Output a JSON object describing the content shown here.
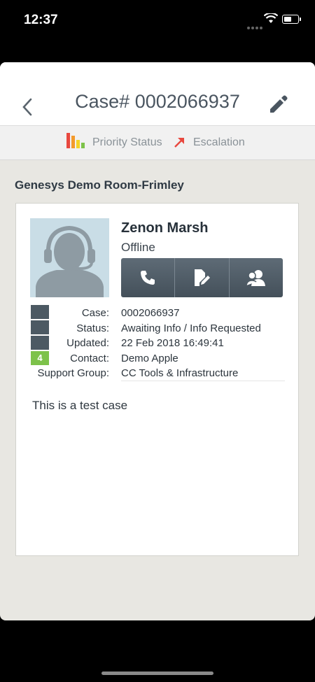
{
  "status_bar": {
    "time": "12:37"
  },
  "header": {
    "title": "Case# 0002066937"
  },
  "subbar": {
    "priority_label": "Priority Status",
    "escalation_label": "Escalation"
  },
  "room": "Genesys Demo Room-Frimley",
  "contact": {
    "name": "Zenon Marsh",
    "presence": "Offline"
  },
  "priority": {
    "level": "4",
    "level_fraction": 0.25
  },
  "details": [
    {
      "key": "Case:",
      "value": "0002066937"
    },
    {
      "key": "Status:",
      "value": "Awaiting Info / Info Requested"
    },
    {
      "key": "Updated:",
      "value": "22 Feb 2018 16:49:41"
    },
    {
      "key": "Contact:",
      "value": "Demo Apple"
    },
    {
      "key": "Support Group:",
      "value": "CC Tools & Infrastructure"
    }
  ],
  "description": "This is a test case",
  "colors": {
    "accent": "#4a5560",
    "priority_green": "#7dc24a",
    "escalation_red": "#e8483f"
  },
  "icons": [
    "back-chevron-icon",
    "pencil-icon",
    "bar-chart-icon",
    "arrow-icon",
    "phone-icon",
    "document-edit-icon",
    "people-icon"
  ]
}
